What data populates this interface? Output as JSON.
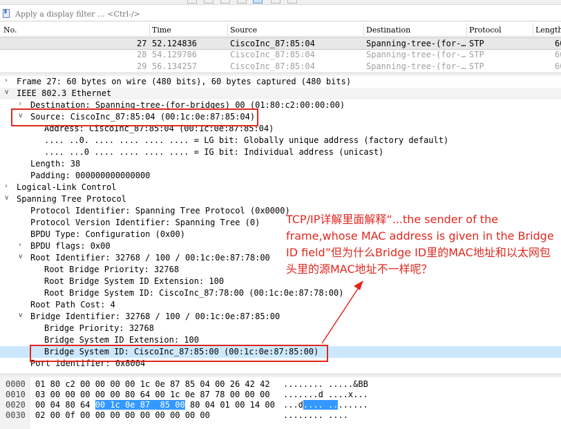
{
  "filter": {
    "placeholder": "Apply a display filter … <Ctrl-/>"
  },
  "packet_list": {
    "columns": [
      "No.",
      "Time",
      "Source",
      "Destination",
      "Protocol",
      "Length"
    ],
    "rows": [
      {
        "no": "27",
        "time": "52.124836",
        "source": "CiscoInc_87:85:04",
        "destination": "Spanning-tree-(for-…",
        "protocol": "STP",
        "length": "60"
      },
      {
        "no": "28",
        "time": "54.129786",
        "source": "CiscoInc_87:85:04",
        "destination": "Spanning-tree-(for-…",
        "protocol": "STP",
        "length": "60"
      },
      {
        "no": "29",
        "time": "56.134257",
        "source": "CiscoInc_87:85:04",
        "destination": "Spanning-tree-(for-…",
        "protocol": "STP",
        "length": "60"
      }
    ]
  },
  "details": {
    "frame": "Frame 27: 60 bytes on wire (480 bits), 60 bytes captured (480 bits)",
    "eth": "IEEE 802.3 Ethernet",
    "eth_dst": "Destination: Spanning-tree-(for-bridges)_00 (01:80:c2:00:00:00)",
    "eth_src": "Source: CiscoInc_87:85:04 (00:1c:0e:87:85:04)",
    "eth_src_addr": "Address: CiscoInc_87:85:04 (00:1c:0e:87:85:04)",
    "eth_src_lg": ".... ..0. .... .... .... .... = LG bit: Globally unique address (factory default)",
    "eth_src_ig": ".... ...0 .... .... .... .... = IG bit: Individual address (unicast)",
    "eth_len": "Length: 38",
    "eth_pad": "Padding: 000000000000000",
    "llc": "Logical-Link Control",
    "stp": "Spanning Tree Protocol",
    "stp_pid": "Protocol Identifier: Spanning Tree Protocol (0x0000)",
    "stp_ver": "Protocol Version Identifier: Spanning Tree (0)",
    "stp_type": "BPDU Type: Configuration (0x00)",
    "stp_flags": "BPDU flags: 0x00",
    "stp_root": "Root Identifier: 32768 / 100 / 00:1c:0e:87:78:00",
    "stp_root_prio": "Root Bridge Priority: 32768",
    "stp_root_ext": "Root Bridge System ID Extension: 100",
    "stp_root_sysid": "Root Bridge System ID: CiscoInc_87:78:00 (00:1c:0e:87:78:00)",
    "stp_cost": "Root Path Cost: 4",
    "stp_bridge": "Bridge Identifier: 32768 / 100 / 00:1c:0e:87:85:00",
    "stp_bridge_prio": "Bridge Priority: 32768",
    "stp_bridge_ext": "Bridge System ID Extension: 100",
    "stp_bridge_sysid": "Bridge System ID: CiscoInc_87:85:00 (00:1c:0e:87:85:00)",
    "stp_port": "Port identifier: 0x8004"
  },
  "annotation": "TCP/IP详解里面解释“...the sender of the frame,whose MAC address is given in the Bridge ID field”但为什么Bridge ID里的MAC地址和以太网包头里的源MAC地址不一样呢？",
  "bytes": {
    "rows": [
      {
        "offset": "0000",
        "hex_a": "01 80 c2 00 00 00 00 1c  0e 87 85 04 00 26 42 42",
        "hex_hl": "",
        "hex_b": "",
        "ascii_a": "........ .....&BB",
        "ascii_hl": "",
        "ascii_b": ""
      },
      {
        "offset": "0010",
        "hex_a": "03 00 00 00 00 00 80 64  00 1c 0e 87 78 00 00 00",
        "hex_hl": "",
        "hex_b": "",
        "ascii_a": ".......d ....x...",
        "ascii_hl": "",
        "ascii_b": ""
      },
      {
        "offset": "0020",
        "hex_a": "00 04 80 64 ",
        "hex_hl": "00 1c 0e 87  85 00",
        "hex_b": " 80 04 01 00 14 00",
        "ascii_a": "...d",
        "ascii_hl": ".... ..",
        "ascii_b": "......"
      },
      {
        "offset": "0030",
        "hex_a": "02 00 0f 00 00 00 00 00  00 00 00 00",
        "hex_hl": "",
        "hex_b": "",
        "ascii_a": "........ ....",
        "ascii_hl": "",
        "ascii_b": ""
      }
    ]
  },
  "colors": {
    "annotation_red": "#e0271f",
    "selection_blue": "#cce8ff",
    "bytes_highlight": "#3399ff"
  }
}
